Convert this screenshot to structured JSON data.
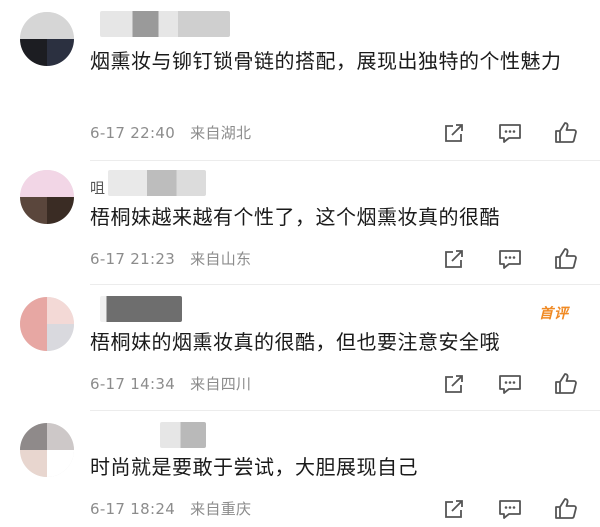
{
  "comments": [
    {
      "text": "烟熏妆与铆钉锁骨链的搭配，展现出独特的个性魅力",
      "date": "6-17 22:40",
      "location": "来自湖北"
    },
    {
      "name_partial": "咀",
      "text": "梧桐妹越来越有个性了，这个烟熏妆真的很酷",
      "date": "6-17 21:23",
      "location": "来自山东"
    },
    {
      "text": "梧桐妹的烟熏妆真的很酷，但也要注意安全哦",
      "date": "6-17 14:34",
      "location": "来自四川",
      "badge": "首评"
    },
    {
      "text": "时尚就是要敢于尝试，大胆展现自己",
      "date": "6-17 18:24",
      "location": "来自重庆"
    }
  ],
  "icons": {
    "share": "share-icon",
    "comment": "comment-icon",
    "like": "like-icon"
  },
  "colors": {
    "meta_text": "#8c8c8c",
    "badge": "#f08a24",
    "icon": "#555555"
  }
}
